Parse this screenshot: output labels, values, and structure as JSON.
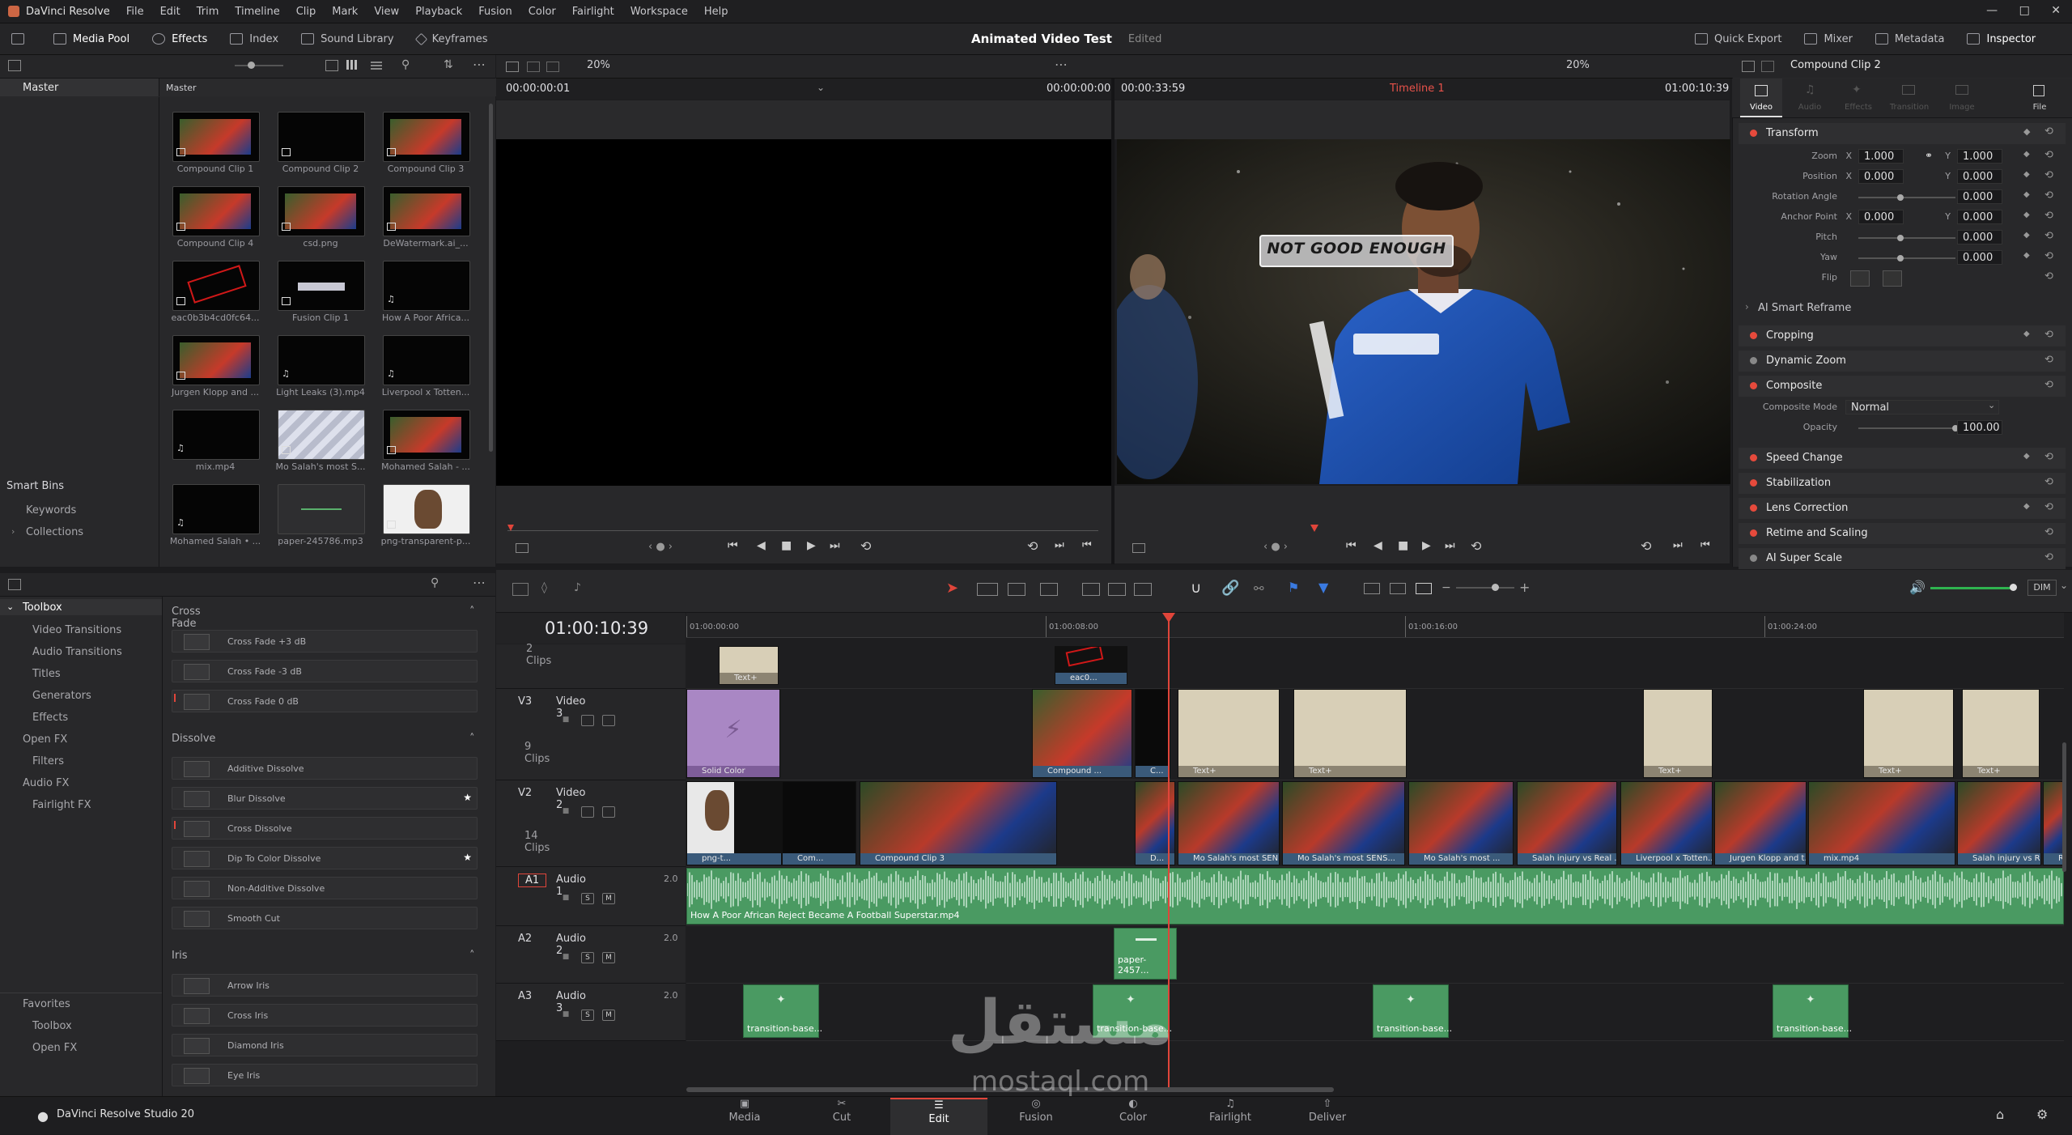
{
  "app": {
    "name": "DaVinci Resolve",
    "project": "Animated Video Test",
    "project_status": "Edited",
    "version": "DaVinci Resolve Studio 20"
  },
  "menu": [
    "File",
    "Edit",
    "Trim",
    "Timeline",
    "Clip",
    "Mark",
    "View",
    "Playback",
    "Fusion",
    "Color",
    "Fairlight",
    "Workspace",
    "Help"
  ],
  "toolbar": {
    "left": [
      "Media Pool",
      "Effects",
      "Index",
      "Sound Library",
      "Keyframes"
    ],
    "right": [
      "Quick Export",
      "Mixer",
      "Metadata",
      "Inspector"
    ]
  },
  "viewer_bar": {
    "zoom_left": "20%",
    "zoom_right": "20%",
    "source_tc": "00:00:00:01",
    "source_duration": "00:00:00:00",
    "timeline_duration": "00:00:33:59",
    "timeline_name": "Timeline 1",
    "timeline_tc": "01:00:10:39",
    "inspector_clip": "Compound Clip 2"
  },
  "media_pool": {
    "bin_left": "Master",
    "bin_right": "Master",
    "items": [
      {
        "label": "Compound Clip 1",
        "kind": "photo"
      },
      {
        "label": "Compound Clip 2",
        "kind": "dark"
      },
      {
        "label": "Compound Clip 3",
        "kind": "photo"
      },
      {
        "label": "Compound Clip 4",
        "kind": "photo"
      },
      {
        "label": "csd.png",
        "kind": "photo"
      },
      {
        "label": "DeWatermark.ai_...",
        "kind": "photo"
      },
      {
        "label": "eac0b3b4cd0fc64...",
        "kind": "stamp"
      },
      {
        "label": "Fusion Clip 1",
        "kind": "bar"
      },
      {
        "label": "How A Poor Africa...",
        "kind": "audio"
      },
      {
        "label": "Jurgen Klopp and ...",
        "kind": "photo"
      },
      {
        "label": "Light Leaks (3).mp4",
        "kind": "audio"
      },
      {
        "label": "Liverpool x Totten...",
        "kind": "audio"
      },
      {
        "label": "mix.mp4",
        "kind": "audio"
      },
      {
        "label": "Mo Salah's most S...",
        "kind": "light"
      },
      {
        "label": "Mohamed Salah - ...",
        "kind": "photo"
      },
      {
        "label": "Mohamed Salah • ...",
        "kind": "audio"
      },
      {
        "label": "paper-245786.mp3",
        "kind": "wave"
      },
      {
        "label": "png-transparent-p...",
        "kind": "portrait"
      }
    ],
    "smart_bins": "Smart Bins",
    "smart_bin_items": [
      "Keywords",
      "Collections"
    ]
  },
  "effects": {
    "tree": [
      "Toolbox",
      "Video Transitions",
      "Audio Transitions",
      "Titles",
      "Generators",
      "Effects",
      "Open FX",
      "Filters",
      "Audio FX",
      "Fairlight FX"
    ],
    "favorites": [
      "Favorites",
      "Toolbox",
      "Open FX"
    ],
    "sections": [
      {
        "title": "Cross Fade",
        "items": [
          "Cross Fade +3 dB",
          "Cross Fade -3 dB",
          "Cross Fade 0 dB"
        ]
      },
      {
        "title": "Dissolve",
        "items": [
          "Additive Dissolve",
          "Blur Dissolve",
          "Cross Dissolve",
          "Dip To Color Dissolve",
          "Non-Additive Dissolve",
          "Smooth Cut"
        ]
      },
      {
        "title": "Iris",
        "items": [
          "Arrow Iris",
          "Cross Iris",
          "Diamond Iris",
          "Eye Iris"
        ]
      }
    ]
  },
  "viewer": {
    "caption": "NOT GOOD ENOUGH"
  },
  "inspector": {
    "tabs": [
      "Video",
      "Audio",
      "Effects",
      "Transition",
      "Image",
      "File"
    ],
    "transform_title": "Transform",
    "zoom_label": "Zoom",
    "zoom_x": "1.000",
    "zoom_y": "1.000",
    "position_label": "Position",
    "pos_x": "0.000",
    "pos_y": "0.000",
    "rotation_label": "Rotation Angle",
    "rotation": "0.000",
    "anchor_label": "Anchor Point",
    "anchor_x": "0.000",
    "anchor_y": "0.000",
    "pitch_label": "Pitch",
    "pitch": "0.000",
    "yaw_label": "Yaw",
    "yaw": "0.000",
    "flip_label": "Flip",
    "ai_reframe": "AI Smart Reframe",
    "cropping": "Cropping",
    "dynamic_zoom": "Dynamic Zoom",
    "composite": "Composite",
    "composite_mode_label": "Composite Mode",
    "composite_mode": "Normal",
    "opacity_label": "Opacity",
    "opacity": "100.00",
    "opacity_level": 1.0,
    "speed_change": "Speed Change",
    "stabilization": "Stabilization",
    "lens_correction": "Lens Correction",
    "retime": "Retime and Scaling",
    "ai_super_scale": "AI Super Scale"
  },
  "timeline": {
    "timecode": "01:00:10:39",
    "ruler": [
      "01:00:00:00",
      "01:00:08:00",
      "01:00:16:00",
      "01:00:24:00"
    ],
    "dim": "DIM",
    "top_clips": "2 Clips",
    "tracks": [
      {
        "id": "V3",
        "name": "Video 3",
        "count": "9 Clips"
      },
      {
        "id": "V2",
        "name": "Video 2",
        "count": "14 Clips"
      },
      {
        "id": "A1",
        "name": "Audio 1",
        "ch": "2.0"
      },
      {
        "id": "A2",
        "name": "Audio 2",
        "ch": "2.0"
      },
      {
        "id": "A3",
        "name": "Audio 3",
        "ch": "2.0"
      }
    ],
    "v4_clips": [
      "Text+",
      "eac0..."
    ],
    "v3_clips": [
      "Solid Color",
      "Compound ...",
      "C...",
      "Text+",
      "Text+",
      "Text+",
      "Text+",
      "Text+"
    ],
    "v2_clips": [
      "png-t...",
      "Com...",
      "Compound Clip 3",
      "D...",
      "Mo Salah's most SEN...",
      "Mo Salah's most SENS...",
      "Mo Salah's most ...",
      "Salah injury vs Real ...",
      "Liverpool x Totten...",
      "Jurgen Klopp and t...",
      "mix.mp4",
      "Salah injury vs R...",
      "R..."
    ],
    "a1_clip": "How A Poor African Reject Became A Football Superstar.mp4",
    "a2_clip": "paper-2457...",
    "a3_clips": [
      "transition-base...",
      "transition-base...",
      "transition-base...",
      "transition-base..."
    ]
  },
  "pages": [
    "Media",
    "Cut",
    "Edit",
    "Fusion",
    "Color",
    "Fairlight",
    "Deliver"
  ],
  "active_page": "Edit",
  "watermark": {
    "arabic": "مستقل",
    "latin": "mostaql.com"
  },
  "colors": {
    "accent_red": "#e64a3c",
    "playhead": "#e0453a",
    "audio_green": "#4a9a62",
    "video_blue": "#3a5a7a"
  }
}
